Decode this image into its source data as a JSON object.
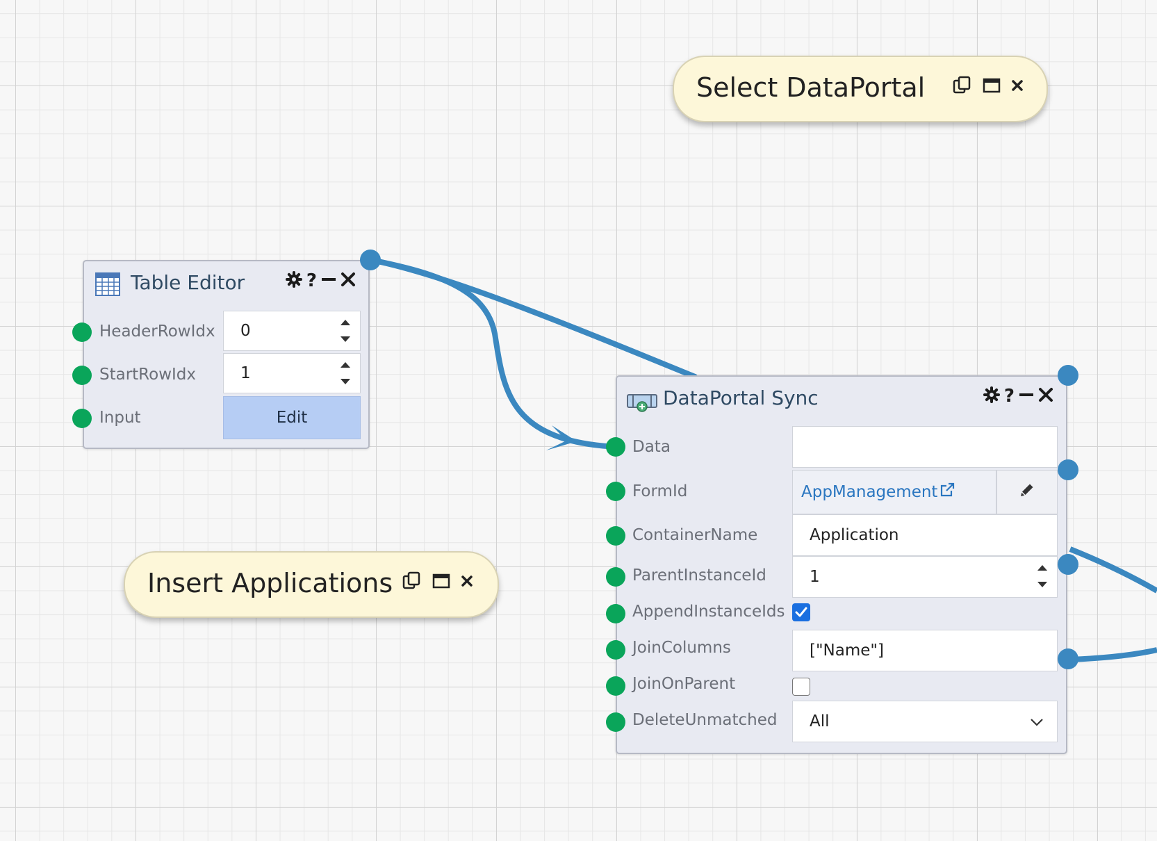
{
  "notes": {
    "select": {
      "title": "Select DataPortal"
    },
    "insert": {
      "title": "Insert Applications"
    }
  },
  "table_editor": {
    "title": "Table Editor",
    "rows": [
      {
        "label": "HeaderRowIdx",
        "value": "0"
      },
      {
        "label": "StartRowIdx",
        "value": "1"
      },
      {
        "label": "Input",
        "button": "Edit"
      }
    ]
  },
  "dataportal_sync": {
    "title": "DataPortal Sync",
    "fields": {
      "data": {
        "label": "Data",
        "value": ""
      },
      "formid": {
        "label": "FormId",
        "value": "AppManagement"
      },
      "containername": {
        "label": "ContainerName",
        "value": "Application"
      },
      "parentinstanceid": {
        "label": "ParentInstanceId",
        "value": "1"
      },
      "appendinstanceids": {
        "label": "AppendInstanceIds",
        "checked": true
      },
      "joincolumns": {
        "label": "JoinColumns",
        "value": "[\"Name\"]"
      },
      "joinonparent": {
        "label": "JoinOnParent",
        "checked": false
      },
      "deleteunmatched": {
        "label": "DeleteUnmatched",
        "value": "All"
      }
    }
  },
  "icons": {
    "node_controls": [
      "gear-icon",
      "help-icon",
      "minimize-icon",
      "close-icon"
    ],
    "note_controls": [
      "copy-icon",
      "maximize-icon",
      "close-icon"
    ]
  },
  "colors": {
    "wire": "#3b88c0",
    "input_port": "#0aa55a",
    "note_bg": "#fdf7d9",
    "node_bg": "#e8eaf2",
    "checkbox_on": "#1a6fe0"
  }
}
